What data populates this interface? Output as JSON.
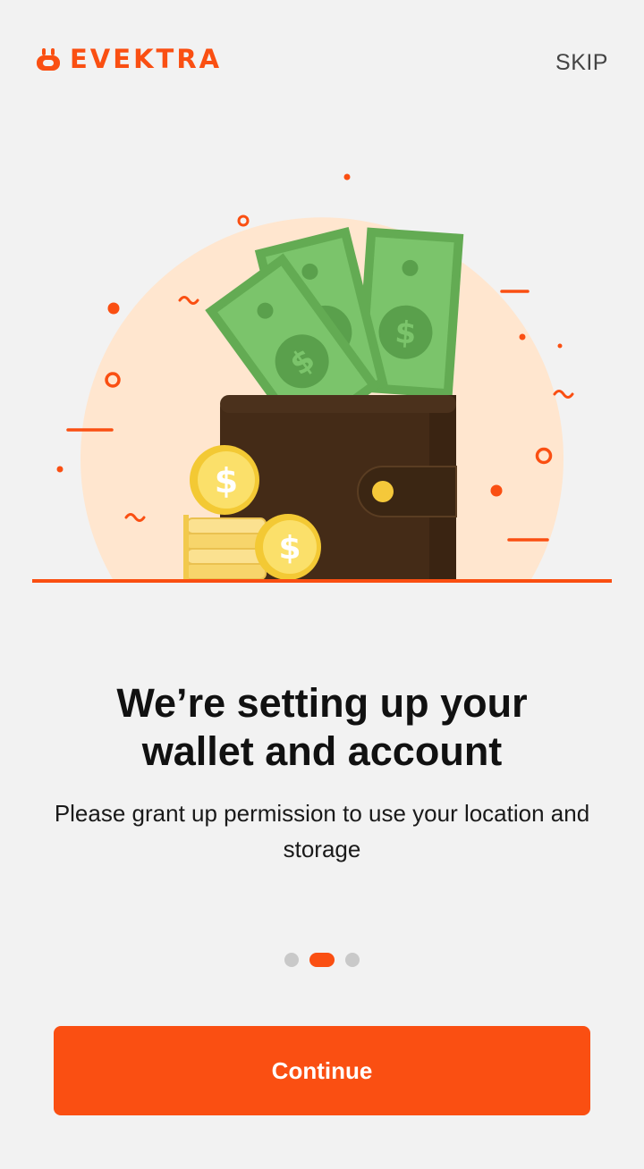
{
  "app": {
    "logo_text": "EVEKTRA",
    "skip_label": "SKIP",
    "brand_color": "#fa4f12"
  },
  "onboarding": {
    "title": "We’re setting up your\nwallet and account",
    "subtitle": "Please grant up permission to use your location and storage",
    "illustration_icon": "wallet-with-money-icon",
    "page_indicator": {
      "total": 3,
      "current": 2
    },
    "continue_label": "Continue"
  }
}
